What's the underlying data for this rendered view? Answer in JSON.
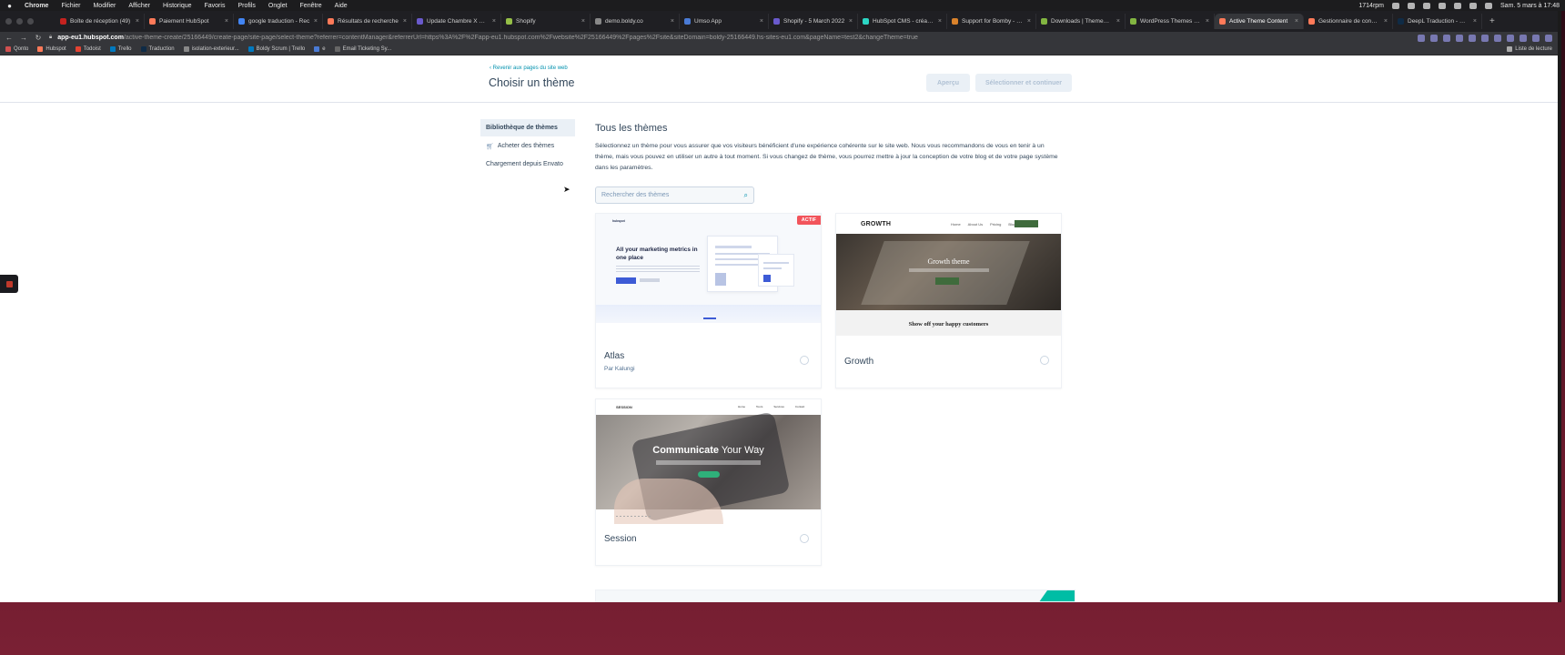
{
  "menubar": {
    "items": [
      "Chrome",
      "Fichier",
      "Modifier",
      "Afficher",
      "Historique",
      "Favoris",
      "Profils",
      "Onglet",
      "Fenêtre",
      "Aide"
    ],
    "speed": "1714rpm",
    "clock": "Sam. 5 mars à 17:48"
  },
  "tabs": [
    {
      "title": "Boîte de réception (49)",
      "color": "#c5221f"
    },
    {
      "title": "Paiement HubSpot",
      "color": "#ff7a59"
    },
    {
      "title": "google traduction - Rec",
      "color": "#4285f4"
    },
    {
      "title": "Résultats de recherche",
      "color": "#ff7a59"
    },
    {
      "title": "Update Chambre X Burr",
      "color": "#6a5acd"
    },
    {
      "title": "Shopify",
      "color": "#95bf47"
    },
    {
      "title": "demo.boldy.co",
      "color": "#888888"
    },
    {
      "title": "Umso App",
      "color": "#4a7bd6"
    },
    {
      "title": "Shopify - 5 March 2022",
      "color": "#6a5acd"
    },
    {
      "title": "HubSpot CMS - création",
      "color": "#2cd5c4"
    },
    {
      "title": "Support for Bomby - Cre",
      "color": "#d9822b"
    },
    {
      "title": "Downloads | ThemeForest",
      "color": "#82b541"
    },
    {
      "title": "WordPress Themes & W",
      "color": "#82b541"
    },
    {
      "title": "Active Theme Content",
      "color": "#ff7a59"
    },
    {
      "title": "Gestionnaire de concept",
      "color": "#ff7a59"
    },
    {
      "title": "DeepL Traduction - Dee",
      "color": "#0f2b46"
    }
  ],
  "active_tab_index": 13,
  "address": {
    "host": "app-eu1.hubspot.com",
    "path": "/active-theme-create/25166449/create-page/site-page/select-theme?referrer=contentManager&referrerUrl=https%3A%2F%2Fapp-eu1.hubspot.com%2Fwebsite%2F25166449%2Fpages%2Fsite&siteDomain=boldy-25166449.hs-sites-eu1.com&pageName=test2&changeTheme=true"
  },
  "bookmarks": [
    "Qonto",
    "Hubspot",
    "Todoist",
    "Trello",
    "Traduction",
    "isolation-exterieur...",
    "Boldy Scrum | Trello",
    "e",
    "Email Ticketing Sy..."
  ],
  "reading_list": "Liste de lecture",
  "page": {
    "back_link": "‹  Revenir aux pages du site web",
    "title": "Choisir un thème",
    "preview_button": "Aperçu",
    "select_button": "Sélectionner et continuer"
  },
  "sidebar": {
    "items": [
      "Bibliothèque de thèmes",
      "Acheter des thèmes",
      "Chargement depuis Envato"
    ]
  },
  "main": {
    "heading": "Tous les thèmes",
    "description": "Sélectionnez un thème pour vous assurer que vos visiteurs bénéficient d'une expérience cohérente sur le site web. Nous vous recommandons de vous en tenir à un thème, mais vous pouvez en utiliser un autre à tout moment. Si vous changez de thème, vous pourrez mettre à jour la conception de votre blog et de votre page système dans les paramètres.",
    "search_placeholder": "Rechercher des thèmes"
  },
  "themes": [
    {
      "name": "Atlas",
      "author": "Par Kalungi",
      "badge": "ACTIF",
      "preview_headline": "All your marketing metrics in one place",
      "preview_logo": "hubspot"
    },
    {
      "name": "Growth",
      "preview_logo": "GROWTH",
      "preview_nav": [
        "Home",
        "About Us",
        "Pricing",
        "Blog"
      ],
      "preview_headline": "Growth theme",
      "preview_strip": "Show off your happy customers"
    },
    {
      "name": "Session",
      "preview_logo": "SESSION",
      "preview_nav": [
        "Home",
        "Tours",
        "Services",
        "Contact"
      ],
      "preview_headline_bold": "Communicate",
      "preview_headline_rest": " Your Way"
    }
  ],
  "colors": {
    "accent": "#0091ae",
    "active_badge": "#f2545b",
    "text": "#33475b"
  }
}
